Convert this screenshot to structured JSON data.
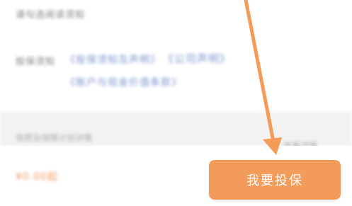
{
  "top_hint": "请勾选阅读须知",
  "clauses": {
    "label": "投保须知",
    "links": [
      "《投保须知及声明》",
      "《公司声明》",
      "《账户与现金价值条款》"
    ]
  },
  "band": {
    "left_text": "保费及保障计划详情",
    "right_text": "查看详情"
  },
  "bottom_bar": {
    "price_text": "¥0.00起",
    "cta_label": "我要投保"
  },
  "colors": {
    "cta_background": "#f39b5a",
    "arrow": "#f59a57",
    "link": "#6f89c9",
    "price": "#f08a4b"
  }
}
